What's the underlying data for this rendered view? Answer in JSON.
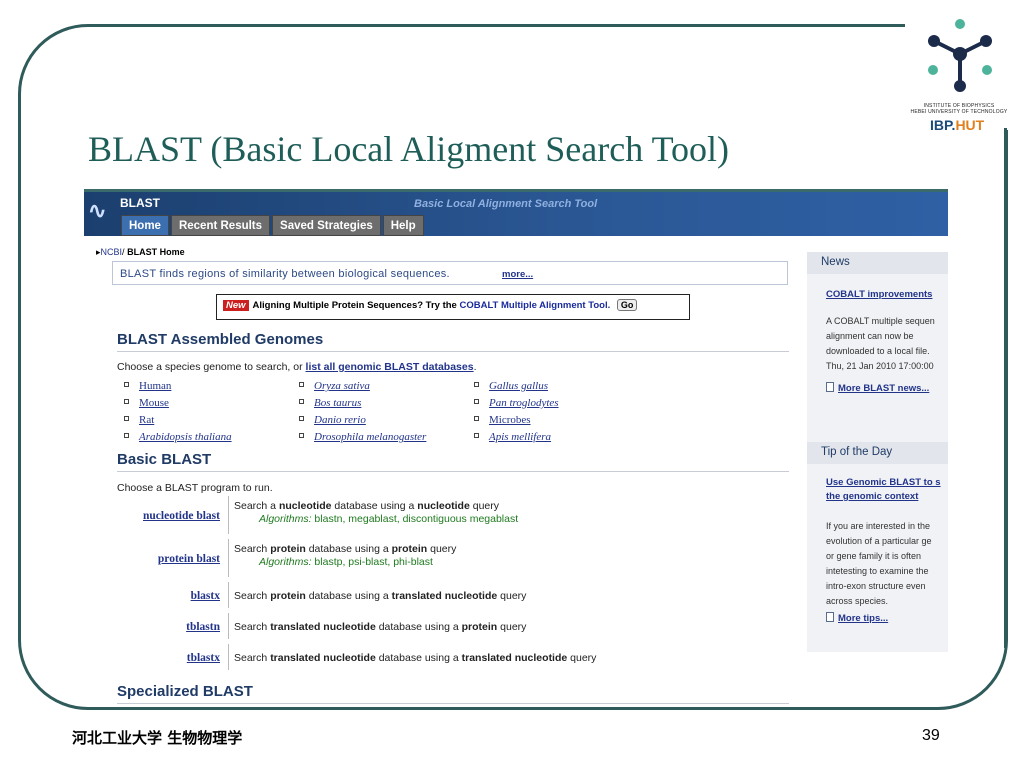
{
  "slide": {
    "title": "BLAST (Basic Local Aligment Search Tool)",
    "footer_left": "河北工业大学  生物物理学",
    "page_number": "39"
  },
  "logo": {
    "institute_line1": "INSTITUTE OF BIOPHYSICS",
    "institute_line2": "HEBEI UNIVERSITY OF TECHNOLOGY",
    "brand_a": "IBP.",
    "brand_b": "HUT"
  },
  "blast": {
    "header": {
      "name": "BLAST",
      "subtitle": "Basic Local Alignment Search Tool",
      "tabs": [
        "Home",
        "Recent Results",
        "Saved Strategies",
        "Help"
      ]
    },
    "breadcrumb": {
      "ncbi": "NCBI",
      "sep": "/",
      "current": "BLAST Home"
    },
    "tagline": "BLAST finds regions of similarity between biological sequences.",
    "tagline_more": "more...",
    "cobalt": {
      "badge": "New",
      "text": "Aligning Multiple Protein Sequences? Try the",
      "link": "COBALT Multiple Alignment Tool.",
      "go": "Go"
    },
    "assembled": {
      "heading": "BLAST Assembled Genomes",
      "intro": "Choose a species genome to search, or",
      "intro_link": "list all genomic BLAST databases",
      "intro_end": ".",
      "genomes": [
        {
          "label": "Human",
          "italic": false
        },
        {
          "label": "Oryza sativa",
          "italic": true
        },
        {
          "label": "Gallus gallus",
          "italic": true
        },
        {
          "label": "Mouse",
          "italic": false
        },
        {
          "label": "Bos taurus",
          "italic": true
        },
        {
          "label": "Pan troglodytes",
          "italic": true
        },
        {
          "label": "Rat",
          "italic": false
        },
        {
          "label": "Danio rerio",
          "italic": true
        },
        {
          "label": "Microbes",
          "italic": false
        },
        {
          "label": "Arabidopsis thaliana",
          "italic": true
        },
        {
          "label": "Drosophila melanogaster",
          "italic": true
        },
        {
          "label": "Apis mellifera",
          "italic": true
        }
      ]
    },
    "basic": {
      "heading": "Basic BLAST",
      "intro": "Choose a BLAST program to run.",
      "programs": [
        {
          "name": "nucleotide blast",
          "desc": [
            "Search a ",
            "nucleotide",
            " database using a ",
            "nucleotide",
            " query"
          ],
          "algo_label": "Algorithms:",
          "algo": " blastn, megablast, discontiguous megablast"
        },
        {
          "name": "protein blast",
          "desc": [
            "Search ",
            "protein",
            " database using a ",
            "protein",
            " query"
          ],
          "algo_label": "Algorithms:",
          "algo": " blastp, psi-blast, phi-blast"
        },
        {
          "name": "blastx",
          "desc": [
            "Search ",
            "protein",
            " database using a ",
            "translated nucleotide",
            " query"
          ],
          "algo_label": "",
          "algo": ""
        },
        {
          "name": "tblastn",
          "desc": [
            "Search ",
            "translated nucleotide",
            " database using a ",
            "protein",
            " query"
          ],
          "algo_label": "",
          "algo": ""
        },
        {
          "name": "tblastx",
          "desc": [
            "Search ",
            "translated nucleotide",
            " database using a ",
            "translated nucleotide",
            " query"
          ],
          "algo_label": "",
          "algo": ""
        }
      ]
    },
    "specialized": {
      "heading": "Specialized BLAST"
    },
    "news": {
      "heading": "News",
      "link": "COBALT improvements",
      "lines": [
        "A COBALT multiple sequen",
        "alignment can now be",
        "downloaded to a local file.",
        "Thu, 21 Jan 2010 17:00:00"
      ],
      "more": "More BLAST news..."
    },
    "tip": {
      "heading": "Tip of the Day",
      "link_lines": [
        "Use Genomic BLAST to s",
        "the genomic context"
      ],
      "lines": [
        "If you are interested in the",
        "evolution of a particular ge",
        "or gene family it is often",
        "intetesting to examine the",
        "intro-exon structure even",
        "across species."
      ],
      "more": "More tips..."
    }
  }
}
